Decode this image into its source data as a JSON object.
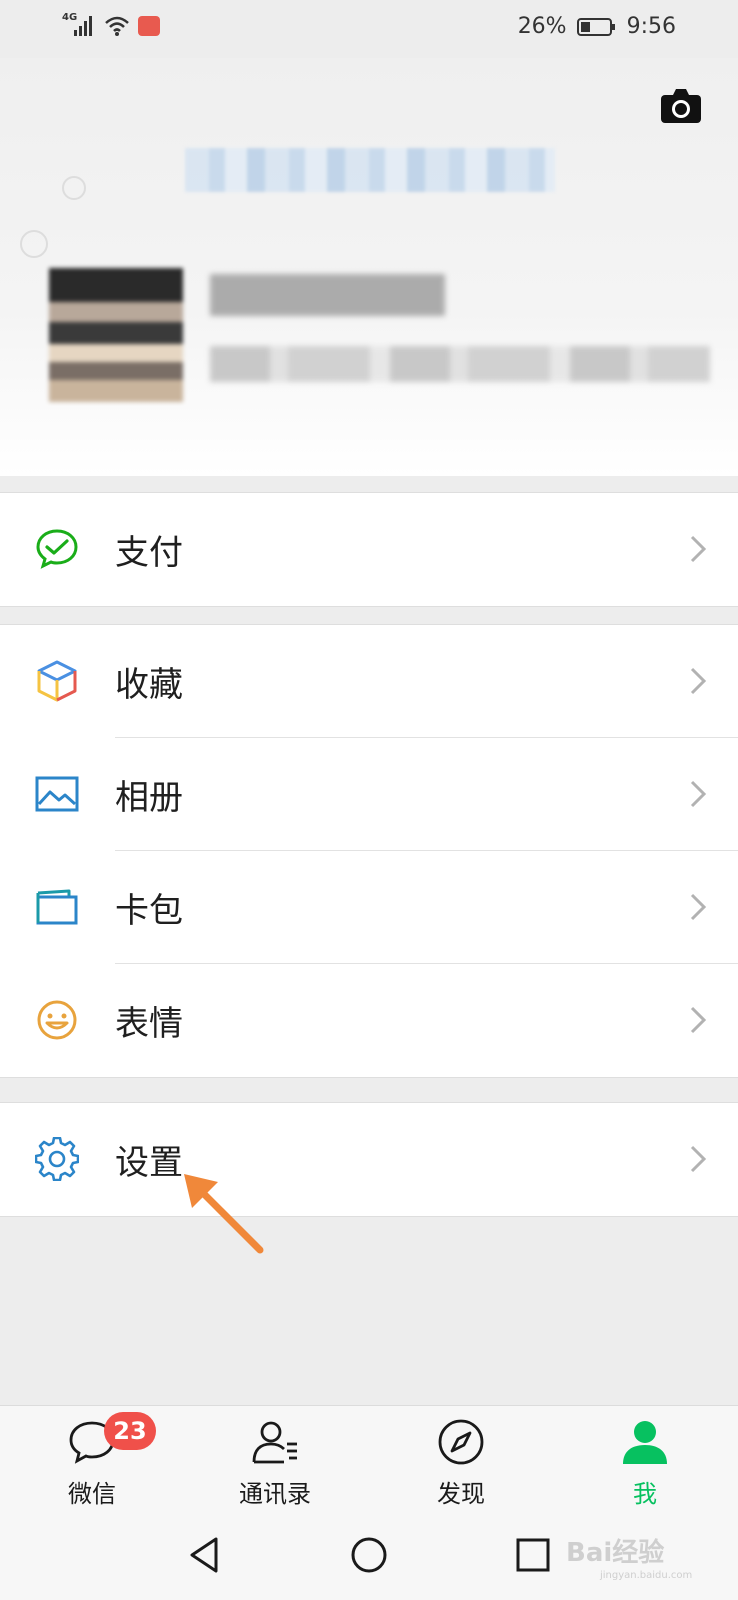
{
  "status_bar": {
    "network": "4G",
    "battery_percent": "26%",
    "time": "9:56"
  },
  "menu": {
    "pay": "支付",
    "favorites": "收藏",
    "album": "相册",
    "cards": "卡包",
    "stickers": "表情",
    "settings": "设置"
  },
  "tabs": {
    "chats": "微信",
    "contacts": "通讯录",
    "discover": "发现",
    "me": "我"
  },
  "chats_badge": "23",
  "watermark": {
    "brand": "Bai经验",
    "sub": "jingyan.baidu.com"
  },
  "colors": {
    "accent_green": "#07c160",
    "badge_red": "#f0504a",
    "arrow_orange": "#f0883a"
  }
}
